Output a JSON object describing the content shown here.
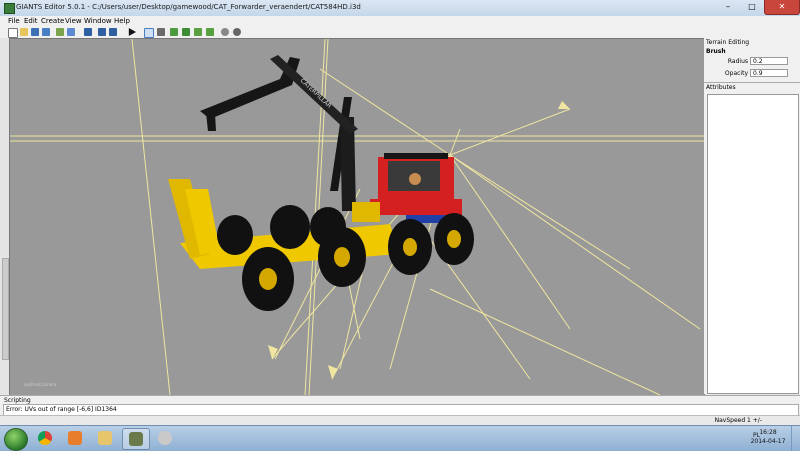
{
  "window": {
    "title": "GIANTS Editor 5.0.1 - C:/Users/user/Desktop/gamewood/CAT_Forwarder_veraendert/CAT584HD.i3d",
    "minimize": "–",
    "maximize": "□",
    "close": "✕"
  },
  "menu": [
    "File",
    "Edit",
    "Create",
    "View",
    "Window",
    "Help"
  ],
  "toolbar_icons": [
    "new-icon",
    "open-icon",
    "save-icon",
    "save-as-icon",
    "export-icon",
    "import-icon",
    "undo-icon",
    "redo-icon",
    "redo-all-icon",
    "play-icon",
    "select-icon",
    "move-icon",
    "rotate-icon",
    "scale-icon",
    "terrain-icon",
    "paint-icon",
    "light-icon",
    "camera-icon"
  ],
  "viewport": {
    "camera_label": "sysFrontCamera",
    "boom_text": "CATERPILLAR"
  },
  "terrain_panel": {
    "title": "Terrain Editing",
    "section": "Brush",
    "radius_label": "Radius",
    "radius_value": "0.2",
    "opacity_label": "Opacity",
    "opacity_value": "0.9"
  },
  "attributes_panel": {
    "title": "Attributes"
  },
  "scripting": {
    "title": "Scripting",
    "lines": [
      "Error: UVs out of range [-6,6] ID1364"
    ]
  },
  "status": {
    "navspeed": "NavSpeed 1 +/-"
  },
  "taskbar": {
    "apps": [
      "start-icon",
      "chrome-icon",
      "media-player-icon",
      "explorer-icon",
      "giants-editor-icon",
      "photo-icon"
    ],
    "tray_lang": "PL",
    "time": "16:28",
    "date": "2014-04-17"
  },
  "colors": {
    "viewport_bg": "#999999",
    "machine_yellow": "#f0c800",
    "cab_red": "#d42020",
    "boom_black": "#161616",
    "debug_lines": "#f0e6a0"
  }
}
